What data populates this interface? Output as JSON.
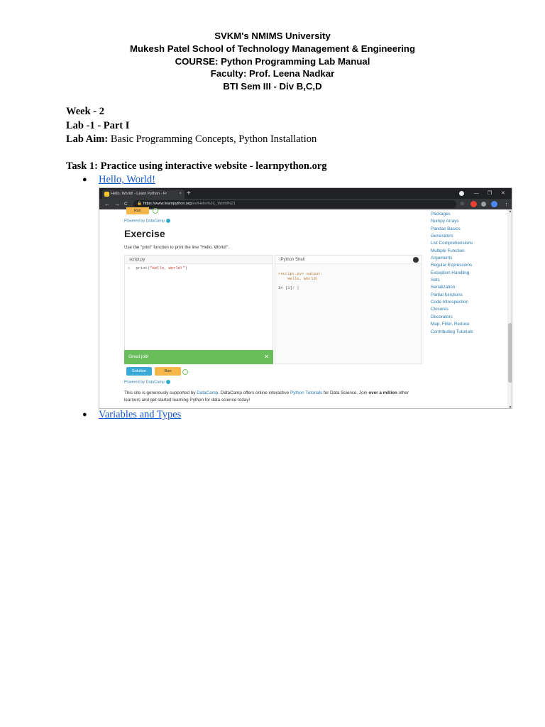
{
  "header": {
    "university": "SVKM's NMIMS University",
    "school": "Mukesh Patel School of Technology Management & Engineering",
    "course": "COURSE: Python Programming Lab Manual",
    "faculty": "Faculty: Prof. Leena Nadkar",
    "batch": "BTI Sem III - Div B,C,D"
  },
  "meta": {
    "week": "Week - 2",
    "lab": "Lab -1 - Part I",
    "aim_label": "Lab Aim:",
    "aim_value": "Basic Programming Concepts, Python Installation"
  },
  "task": {
    "title": "Task 1: Practice using interactive website - learnpython.org",
    "bullets": [
      {
        "symbol": "●",
        "label": "Hello, World!"
      },
      {
        "symbol": "●",
        "label": "Variables and Types"
      }
    ]
  },
  "browser": {
    "tab_title": "Hello, World! - Learn Python - Fr",
    "tab_close": "×",
    "new_tab": "+",
    "url_domain": "https://www.learnpython.org",
    "url_path": "/en/Hello%2C_World%21",
    "win_controls": [
      "—",
      "❐",
      "✕"
    ],
    "nav": [
      "←",
      "→",
      "C"
    ],
    "toolbar_icons": [
      "☆",
      "⋮"
    ]
  },
  "learnpython": {
    "run_top": "Run",
    "powered_by": "Powered by DataCamp",
    "exercise_title": "Exercise",
    "exercise_text": "Use the \"print\" function to print the line \"Hello, World!\".",
    "editor_tab": "script.py",
    "code_line_no": "1",
    "code_prefix": "print(",
    "code_string": "\"Hello, World!\"",
    "code_suffix": ")",
    "success_msg": "Great job!",
    "success_close": "✕",
    "shell_tab": "IPython Shell",
    "shell_output_1": "<script.py> output:",
    "shell_output_2": "    Hello, World!",
    "shell_prompt": "In [1]: |",
    "solution_button": "Solution",
    "run_button": "Run",
    "powered_by_bottom": "Powered by DataCamp",
    "support_pre": "This site is generously supported by ",
    "support_link1": "DataCamp",
    "support_mid": ". DataCamp offers online interactive ",
    "support_link2": "Python Tutorials",
    "support_mid2": " for Data Science. Join ",
    "support_bold": "over a million",
    "support_post": " other learners and get started learning Python for data science today!",
    "sidebar_links": [
      "Packages",
      "Numpy Arrays",
      "Pandas Basics",
      "Generators",
      "List Comprehensions",
      "Multiple Function",
      "Arguments",
      "Regular Expressions",
      "Exception Handling",
      "Sets",
      "Serialization",
      "Partial functions",
      "Code Introspection",
      "Closures",
      "Decorators",
      "Map, Filter, Reduce",
      "Contributing Tutorials"
    ]
  },
  "colors": {
    "link": "#1155cc",
    "success_green": "#6abd5b",
    "solution_blue": "#3aa9d8",
    "run_orange": "#f6b648",
    "chrome_dark": "#202124"
  }
}
